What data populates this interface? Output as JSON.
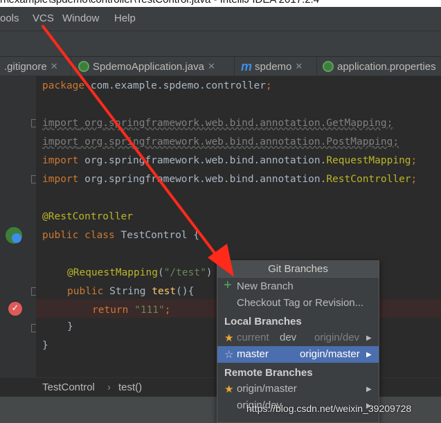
{
  "window": {
    "title": "n\\example\\spdemo\\controller\\TestControl.java - IntelliJ IDEA 2017.2.4"
  },
  "menu": {
    "items": [
      "ools",
      "VCS",
      "Window",
      "Help"
    ]
  },
  "tabs": [
    {
      "label": ".gitignore"
    },
    {
      "label": "SpdemoApplication.java"
    },
    {
      "label": "spdemo"
    },
    {
      "label": "application.properties"
    }
  ],
  "code": {
    "package_kw": "package",
    "package_name": " com.example.spdemo.controller",
    "semicolon": ";",
    "import_kw": "import",
    "import1": " org.springframework.web.bind.annotation.GetMapping;",
    "import2": " org.springframework.web.bind.annotation.PostMapping;",
    "import3_pkg": " org.springframework.web.bind.annotation.",
    "import3_cls": "RequestMapping",
    "import4_pkg": " org.springframework.web.bind.annotation.",
    "import4_cls": "RestController",
    "annotation1": "@RestController",
    "public_kw": "public",
    "class_kw": " class",
    "class_name": " TestControl {",
    "annotation2": "@RequestMapping",
    "annotation2_args_open": "(",
    "annotation2_str": "\"/test\"",
    "annotation2_args_close": ")",
    "method_type": " String",
    "method_name": " test",
    "method_parens": "(){",
    "return_kw": "return",
    "return_str": " \"111\"",
    "close_brace": "}"
  },
  "breadcrumb": {
    "items": [
      "TestControl",
      "test()"
    ],
    "separator": "›"
  },
  "popup": {
    "title": "Git Branches",
    "new_branch": "New Branch",
    "checkout_tag": "Checkout Tag or Revision...",
    "local_header": "Local Branches",
    "local_current_label": "current",
    "local_current_name": "dev",
    "local_current_remote": "origin/dev",
    "local_master_name": "master",
    "local_master_remote": "origin/master",
    "remote_header": "Remote Branches",
    "remote1": "origin/master",
    "remote2": "origin/dev"
  },
  "watermark": "https://blog.csdn.net/weixin_39209728",
  "colors": {
    "editor_bg": "#2b2b2b",
    "selection": "#4b6eaf",
    "keyword": "#cc7832",
    "annotation": "#bbb529",
    "string": "#6a8759",
    "arrow": "#ff2a1a"
  }
}
